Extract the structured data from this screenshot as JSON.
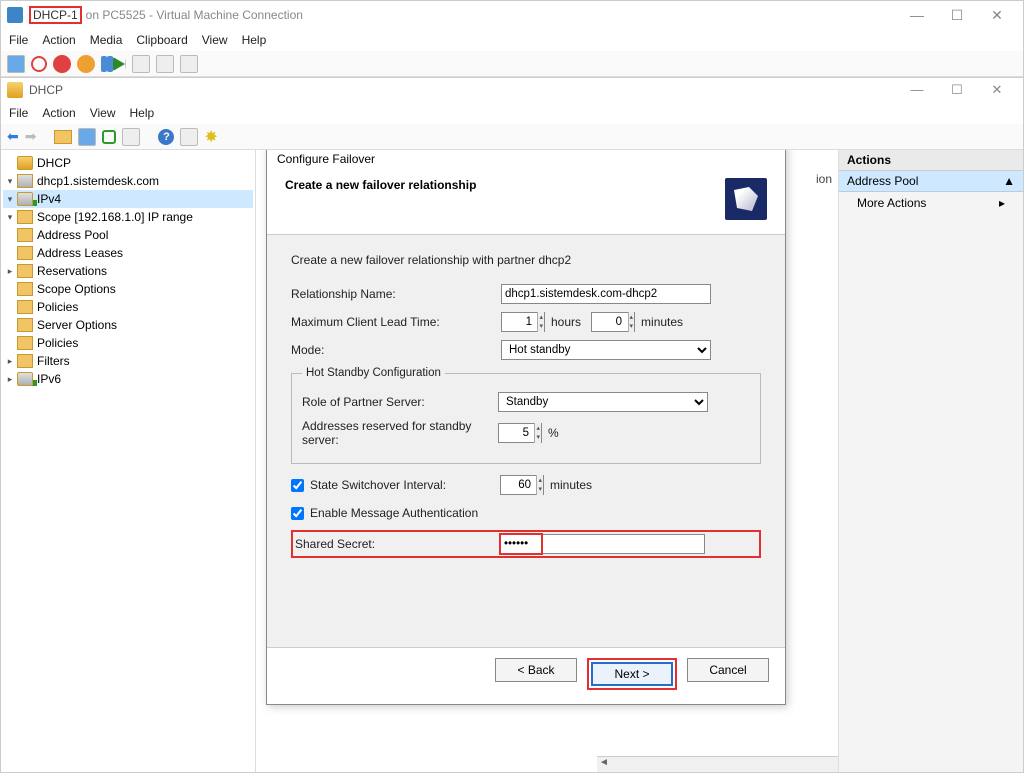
{
  "vm": {
    "title_highlight": "DHCP-1",
    "title_rest": "on PC5525 - Virtual Machine Connection",
    "menu": [
      "File",
      "Action",
      "Media",
      "Clipboard",
      "View",
      "Help"
    ]
  },
  "dhcp": {
    "title": "DHCP",
    "menu": [
      "File",
      "Action",
      "View",
      "Help"
    ]
  },
  "tree": {
    "root": "DHCP",
    "server": "dhcp1.sistemdesk.com",
    "ipv4": "IPv4",
    "scope": "Scope [192.168.1.0] IP range",
    "pool": "Address Pool",
    "leases": "Address Leases",
    "reservations": "Reservations",
    "scopeopts": "Scope Options",
    "policies1": "Policies",
    "serveropts": "Server Options",
    "policies2": "Policies",
    "filters": "Filters",
    "ipv6": "IPv6"
  },
  "actions": {
    "header": "Actions",
    "section": "Address Pool",
    "more": "More Actions"
  },
  "dialog": {
    "title": "Configure Failover",
    "heading": "Create a new failover relationship",
    "intro": "Create a new failover relationship with partner dhcp2",
    "relationship_label": "Relationship Name:",
    "relationship_value": "dhcp1.sistemdesk.com-dhcp2",
    "mclt_label": "Maximum Client Lead Time:",
    "mclt_hours": "1",
    "mclt_hours_unit": "hours",
    "mclt_minutes": "0",
    "mclt_minutes_unit": "minutes",
    "mode_label": "Mode:",
    "mode_value": "Hot standby",
    "group_legend": "Hot Standby Configuration",
    "role_label": "Role of Partner Server:",
    "role_value": "Standby",
    "reserved_label": "Addresses reserved for standby server:",
    "reserved_value": "5",
    "reserved_unit": "%",
    "ssi_label": "State Switchover Interval:",
    "ssi_value": "60",
    "ssi_unit": "minutes",
    "auth_label": "Enable Message Authentication",
    "secret_label": "Shared Secret:",
    "secret_value": "••••••",
    "back": "< Back",
    "next": "Next >",
    "cancel": "Cancel"
  },
  "center_cols_hint": "ion"
}
